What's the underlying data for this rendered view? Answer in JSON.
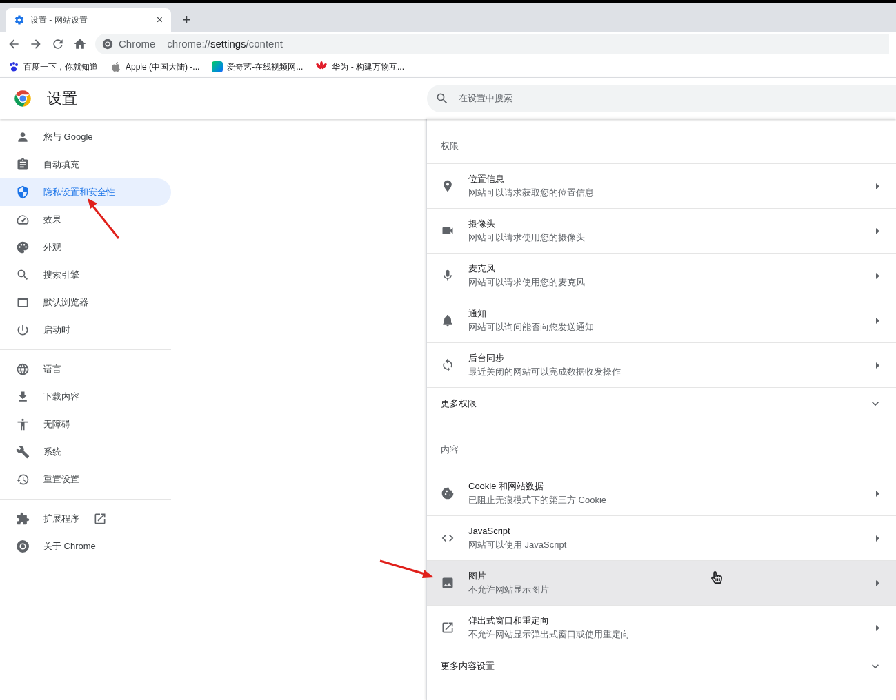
{
  "tab": {
    "title": "设置 - 网站设置",
    "close": "×",
    "new_tab": "+"
  },
  "address_bar": {
    "site": "Chrome",
    "url_prefix": "chrome://",
    "url_path": "settings",
    "url_suffix": "/content"
  },
  "bookmarks": [
    {
      "label": "百度一下，你就知道"
    },
    {
      "label": "Apple (中国大陆) -..."
    },
    {
      "label": "爱奇艺-在线视频网..."
    },
    {
      "label": "华为 - 构建万物互..."
    }
  ],
  "header": {
    "title": "设置",
    "search": {
      "placeholder": "在设置中搜索"
    }
  },
  "sidebar": {
    "groups": [
      [
        {
          "label": "您与 Google",
          "selected": false,
          "external": false
        },
        {
          "label": "自动填充",
          "selected": false,
          "external": false
        },
        {
          "label": "隐私设置和安全性",
          "selected": true,
          "external": false
        },
        {
          "label": "效果",
          "selected": false,
          "external": false
        },
        {
          "label": "外观",
          "selected": false,
          "external": false
        },
        {
          "label": "搜索引擎",
          "selected": false,
          "external": false
        },
        {
          "label": "默认浏览器",
          "selected": false,
          "external": false
        },
        {
          "label": "启动时",
          "selected": false,
          "external": false
        }
      ],
      [
        {
          "label": "语言",
          "selected": false,
          "external": false
        },
        {
          "label": "下载内容",
          "selected": false,
          "external": false
        },
        {
          "label": "无障碍",
          "selected": false,
          "external": false
        },
        {
          "label": "系统",
          "selected": false,
          "external": false
        },
        {
          "label": "重置设置",
          "selected": false,
          "external": false
        }
      ],
      [
        {
          "label": "扩展程序",
          "selected": false,
          "external": true
        },
        {
          "label": "关于 Chrome",
          "selected": false,
          "external": false
        }
      ]
    ]
  },
  "permissions": {
    "heading": "权限",
    "rows": [
      {
        "title": "位置信息",
        "subtitle": "网站可以请求获取您的位置信息",
        "hovered": false
      },
      {
        "title": "摄像头",
        "subtitle": "网站可以请求使用您的摄像头",
        "hovered": false
      },
      {
        "title": "麦克风",
        "subtitle": "网站可以请求使用您的麦克风",
        "hovered": false
      },
      {
        "title": "通知",
        "subtitle": "网站可以询问能否向您发送通知",
        "hovered": false
      },
      {
        "title": "后台同步",
        "subtitle": "最近关闭的网站可以完成数据收发操作",
        "hovered": false
      }
    ],
    "more": {
      "label": "更多权限",
      "expanded": false
    }
  },
  "content": {
    "heading": "内容",
    "rows": [
      {
        "title": "Cookie 和网站数据",
        "subtitle": "已阻止无痕模式下的第三方 Cookie",
        "hovered": false
      },
      {
        "title": "JavaScript",
        "subtitle": "网站可以使用 JavaScript",
        "hovered": false
      },
      {
        "title": "图片",
        "subtitle": "不允许网站显示图片",
        "hovered": true
      },
      {
        "title": "弹出式窗口和重定向",
        "subtitle": "不允许网站显示弹出式窗口或使用重定向",
        "hovered": false
      }
    ],
    "more": {
      "label": "更多内容设置",
      "expanded": false
    }
  }
}
